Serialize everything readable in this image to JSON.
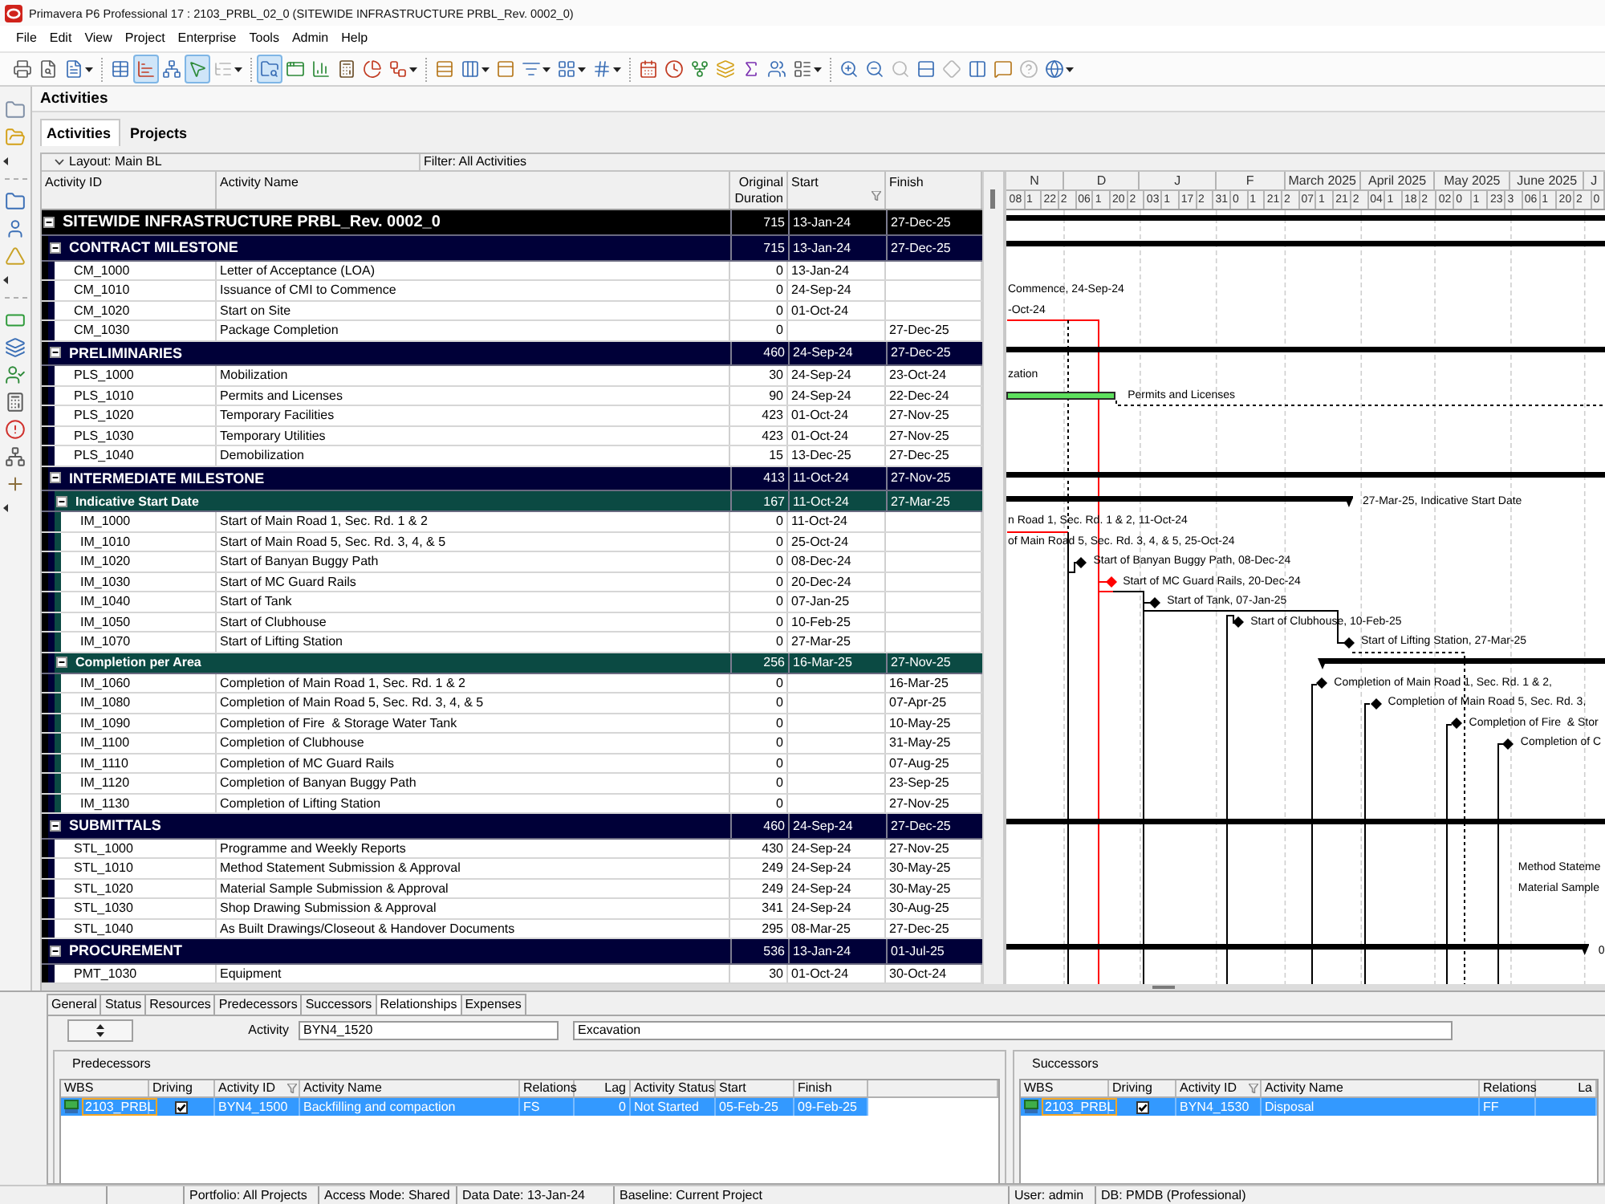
{
  "window": {
    "title": "Primavera P6 Professional 17 : 2103_PRBL_02_0 (SITEWIDE INFRASTRUCTURE PRBL_Rev. 0002_0)"
  },
  "menu": [
    "File",
    "Edit",
    "View",
    "Project",
    "Enterprise",
    "Tools",
    "Admin",
    "Help"
  ],
  "toolbar": [
    [
      {
        "kind": "printer",
        "pressed": false,
        "disabled": false,
        "dropdown": false
      },
      {
        "kind": "preview",
        "pressed": false,
        "disabled": false,
        "dropdown": false
      },
      {
        "kind": "page",
        "pressed": false,
        "disabled": false,
        "dropdown": true
      }
    ],
    [
      {
        "kind": "table",
        "pressed": false,
        "disabled": false,
        "dropdown": false
      },
      {
        "kind": "gantt",
        "pressed": true,
        "disabled": false,
        "dropdown": false
      },
      {
        "kind": "network",
        "pressed": false,
        "disabled": false,
        "dropdown": false
      },
      {
        "kind": "pointer",
        "pressed": true,
        "disabled": false,
        "dropdown": false
      },
      {
        "kind": "hierarchy",
        "pressed": false,
        "disabled": true,
        "dropdown": true
      }
    ],
    [
      {
        "kind": "finder",
        "pressed": true,
        "disabled": false,
        "dropdown": false
      },
      {
        "kind": "window",
        "pressed": false,
        "disabled": false,
        "dropdown": false
      },
      {
        "kind": "bars",
        "pressed": false,
        "disabled": false,
        "dropdown": false
      },
      {
        "kind": "calculator",
        "pressed": false,
        "disabled": false,
        "dropdown": false
      },
      {
        "kind": "chart",
        "pressed": false,
        "disabled": false,
        "dropdown": false
      },
      {
        "kind": "workflow",
        "pressed": false,
        "disabled": false,
        "dropdown": true
      }
    ],
    [
      {
        "kind": "align",
        "pressed": false,
        "disabled": false,
        "dropdown": false
      },
      {
        "kind": "columns",
        "pressed": false,
        "disabled": false,
        "dropdown": true
      },
      {
        "kind": "panel",
        "pressed": false,
        "disabled": false,
        "dropdown": false
      },
      {
        "kind": "filter",
        "pressed": false,
        "disabled": false,
        "dropdown": true
      },
      {
        "kind": "layout",
        "pressed": false,
        "disabled": false,
        "dropdown": true
      },
      {
        "kind": "hash",
        "pressed": false,
        "disabled": false,
        "dropdown": true
      }
    ],
    [
      {
        "kind": "calendar",
        "pressed": false,
        "disabled": false,
        "dropdown": false
      },
      {
        "kind": "clock",
        "pressed": false,
        "disabled": false,
        "dropdown": false
      },
      {
        "kind": "fork",
        "pressed": false,
        "disabled": false,
        "dropdown": false
      },
      {
        "kind": "layers",
        "pressed": false,
        "disabled": false,
        "dropdown": false
      },
      {
        "kind": "sigma",
        "pressed": false,
        "disabled": false,
        "dropdown": false
      },
      {
        "kind": "users",
        "pressed": false,
        "disabled": false,
        "dropdown": false
      },
      {
        "kind": "list",
        "pressed": false,
        "disabled": false,
        "dropdown": true
      }
    ],
    [
      {
        "kind": "zoomin",
        "pressed": false,
        "disabled": false,
        "dropdown": false
      },
      {
        "kind": "zoomout",
        "pressed": false,
        "disabled": false,
        "dropdown": false
      },
      {
        "kind": "magnifier",
        "pressed": false,
        "disabled": true,
        "dropdown": false
      },
      {
        "kind": "rows",
        "pressed": false,
        "disabled": false,
        "dropdown": false
      },
      {
        "kind": "diamond",
        "pressed": false,
        "disabled": true,
        "dropdown": false
      },
      {
        "kind": "split",
        "pressed": false,
        "disabled": false,
        "dropdown": false
      },
      {
        "kind": "message",
        "pressed": false,
        "disabled": false,
        "dropdown": false
      },
      {
        "kind": "help",
        "pressed": false,
        "disabled": true,
        "dropdown": false
      },
      {
        "kind": "globe",
        "pressed": false,
        "disabled": false,
        "dropdown": true
      }
    ]
  ],
  "view": {
    "title": "Activities",
    "tabs": [
      {
        "label": "Activities",
        "selected": true
      },
      {
        "label": "Projects",
        "selected": false
      }
    ],
    "layout": "Layout: Main BL",
    "filter": "Filter: All Activities",
    "columns": [
      {
        "label": "Activity ID",
        "sorted": false
      },
      {
        "label": "Activity Name",
        "sorted": false
      },
      {
        "label": "Original Duration",
        "sorted": false
      },
      {
        "label": "Start",
        "sorted": true
      },
      {
        "label": "Finish",
        "sorted": false
      }
    ],
    "tree": {
      "kind": "wbs",
      "name": "SITEWIDE INFRASTRUCTURE PRBL_Rev. 0002_0",
      "duration": "715",
      "start": "13-Jan-24",
      "finish": "27-Dec-25",
      "expanded": true,
      "gantt": {
        "kind": "summary"
      },
      "children": [
        {
          "kind": "wbs",
          "name": "CONTRACT MILESTONE",
          "duration": "715",
          "start": "13-Jan-24",
          "finish": "27-Dec-25",
          "expanded": true,
          "gantt": {
            "kind": "summary"
          },
          "children": [
            {
              "kind": "activity",
              "id": "CM_1000",
              "name": "Letter of Acceptance (LOA)",
              "duration": "0",
              "start": "13-Jan-24"
            },
            {
              "kind": "activity",
              "id": "CM_1010",
              "name": "Issuance of CMI to Commence",
              "duration": "0",
              "start": "24-Sep-24",
              "gantt": {
                "kind": "clipped",
                "label": "Commence, 24-Sep-24"
              }
            },
            {
              "kind": "activity",
              "id": "CM_1020",
              "name": "Start on Site",
              "duration": "0",
              "start": "01-Oct-24",
              "gantt": {
                "kind": "clipped",
                "label": "-Oct-24"
              }
            },
            {
              "kind": "activity",
              "id": "CM_1030",
              "name": "Package Completion",
              "duration": "0",
              "finish": "27-Dec-25"
            }
          ]
        },
        {
          "kind": "wbs",
          "name": "PRELIMINARIES",
          "duration": "460",
          "start": "24-Sep-24",
          "finish": "27-Dec-25",
          "expanded": true,
          "gantt": {
            "kind": "summary"
          },
          "children": [
            {
              "kind": "activity",
              "id": "PLS_1000",
              "name": "Mobilization",
              "duration": "30",
              "start": "24-Sep-24",
              "finish": "23-Oct-24",
              "gantt": {
                "kind": "clipped",
                "label": "zation"
              }
            },
            {
              "kind": "activity",
              "id": "PLS_1010",
              "name": "Permits and Licenses",
              "duration": "90",
              "start": "24-Sep-24",
              "finish": "22-Dec-24",
              "gantt": {
                "kind": "task",
                "label": "Permits and Licenses",
                "critical": false
              }
            },
            {
              "kind": "activity",
              "id": "PLS_1020",
              "name": "Temporary Facilities",
              "duration": "423",
              "start": "01-Oct-24",
              "finish": "27-Nov-25"
            },
            {
              "kind": "activity",
              "id": "PLS_1030",
              "name": "Temporary Utilities",
              "duration": "423",
              "start": "01-Oct-24",
              "finish": "27-Nov-25"
            },
            {
              "kind": "activity",
              "id": "PLS_1040",
              "name": "Demobilization",
              "duration": "15",
              "start": "13-Dec-25",
              "finish": "27-Dec-25"
            }
          ]
        },
        {
          "kind": "wbs",
          "name": "INTERMEDIATE MILESTONE",
          "duration": "413",
          "start": "11-Oct-24",
          "finish": "27-Nov-25",
          "expanded": true,
          "gantt": {
            "kind": "summary"
          },
          "children": [
            {
              "kind": "wbs",
              "name": "Indicative Start Date",
              "duration": "167",
              "start": "11-Oct-24",
              "finish": "27-Mar-25",
              "expanded": true,
              "gantt": {
                "kind": "summary",
                "label": "27-Mar-25, Indicative Start Date"
              },
              "children": [
                {
                  "kind": "activity",
                  "id": "IM_1000",
                  "name": "Start of Main Road 1, Sec. Rd. 1 & 2",
                  "duration": "0",
                  "start": "11-Oct-24",
                  "gantt": {
                    "kind": "clipped",
                    "label": "n Road 1, Sec. Rd. 1 & 2, 11-Oct-24"
                  }
                },
                {
                  "kind": "activity",
                  "id": "IM_1010",
                  "name": "Start of Main Road 5, Sec. Rd. 3, 4, & 5",
                  "duration": "0",
                  "start": "25-Oct-24",
                  "gantt": {
                    "kind": "clipped",
                    "label": "of Main Road 5, Sec. Rd. 3, 4, & 5, 25-Oct-24"
                  }
                },
                {
                  "kind": "activity",
                  "id": "IM_1020",
                  "name": "Start of Banyan Buggy Path",
                  "duration": "0",
                  "start": "08-Dec-24",
                  "gantt": {
                    "kind": "milestone",
                    "label": "Start of Banyan Buggy Path, 08-Dec-24",
                    "critical": false
                  }
                },
                {
                  "kind": "activity",
                  "id": "IM_1030",
                  "name": "Start of MC Guard Rails",
                  "duration": "0",
                  "start": "20-Dec-24",
                  "gantt": {
                    "kind": "milestone",
                    "label": "Start of MC Guard Rails, 20-Dec-24",
                    "critical": true
                  }
                },
                {
                  "kind": "activity",
                  "id": "IM_1040",
                  "name": "Start of Tank",
                  "duration": "0",
                  "start": "07-Jan-25",
                  "gantt": {
                    "kind": "milestone",
                    "label": "Start of Tank, 07-Jan-25",
                    "critical": false
                  }
                },
                {
                  "kind": "activity",
                  "id": "IM_1050",
                  "name": "Start of Clubhouse",
                  "duration": "0",
                  "start": "10-Feb-25",
                  "gantt": {
                    "kind": "milestone",
                    "label": "Start of Clubhouse, 10-Feb-25",
                    "critical": false
                  }
                },
                {
                  "kind": "activity",
                  "id": "IM_1070",
                  "name": "Start of Lifting Station",
                  "duration": "0",
                  "start": "27-Mar-25",
                  "gantt": {
                    "kind": "milestone",
                    "label": "Start of Lifting Station, 27-Mar-25",
                    "critical": false
                  }
                }
              ]
            },
            {
              "kind": "wbs",
              "name": "Completion per Area",
              "duration": "256",
              "start": "16-Mar-25",
              "finish": "27-Nov-25",
              "expanded": true,
              "gantt": {
                "kind": "summary"
              },
              "children": [
                {
                  "kind": "activity",
                  "id": "IM_1060",
                  "name": "Completion of Main Road 1, Sec. Rd. 1 & 2",
                  "duration": "0",
                  "finish": "16-Mar-25",
                  "gantt": {
                    "kind": "milestone",
                    "label": "Completion of Main Road 1, Sec. Rd. 1 & 2,",
                    "critical": false
                  }
                },
                {
                  "kind": "activity",
                  "id": "IM_1080",
                  "name": "Completion of Main Road 5, Sec. Rd. 3, 4, & 5",
                  "duration": "0",
                  "finish": "07-Apr-25",
                  "gantt": {
                    "kind": "milestone",
                    "label": "Completion of Main Road 5, Sec. Rd. 3,",
                    "critical": false
                  }
                },
                {
                  "kind": "activity",
                  "id": "IM_1090",
                  "name": "Completion of Fire  & Storage Water Tank",
                  "duration": "0",
                  "finish": "10-May-25",
                  "gantt": {
                    "kind": "milestone",
                    "label": "Completion of Fire  & Stor",
                    "critical": false
                  }
                },
                {
                  "kind": "activity",
                  "id": "IM_1100",
                  "name": "Completion of Clubhouse",
                  "duration": "0",
                  "finish": "31-May-25",
                  "gantt": {
                    "kind": "milestone",
                    "label": "Completion of C",
                    "critical": false
                  }
                },
                {
                  "kind": "activity",
                  "id": "IM_1110",
                  "name": "Completion of MC Guard Rails",
                  "duration": "0",
                  "finish": "07-Aug-25"
                },
                {
                  "kind": "activity",
                  "id": "IM_1120",
                  "name": "Completion of Banyan Buggy Path",
                  "duration": "0",
                  "finish": "23-Sep-25"
                },
                {
                  "kind": "activity",
                  "id": "IM_1130",
                  "name": "Completion of Lifting Station",
                  "duration": "0",
                  "finish": "27-Nov-25"
                }
              ]
            }
          ]
        },
        {
          "kind": "wbs",
          "name": "SUBMITTALS",
          "duration": "460",
          "start": "24-Sep-24",
          "finish": "27-Dec-25",
          "expanded": true,
          "gantt": {
            "kind": "summary"
          },
          "children": [
            {
              "kind": "activity",
              "id": "STL_1000",
              "name": "Programme and Weekly Reports",
              "duration": "430",
              "start": "24-Sep-24",
              "finish": "27-Nov-25"
            },
            {
              "kind": "activity",
              "id": "STL_1010",
              "name": "Method Statement Submission & Approval",
              "duration": "249",
              "start": "24-Sep-24",
              "finish": "30-May-25",
              "gantt": {
                "kind": "label",
                "label": "Method Stateme"
              }
            },
            {
              "kind": "activity",
              "id": "STL_1020",
              "name": "Material Sample Submission & Approval",
              "duration": "249",
              "start": "24-Sep-24",
              "finish": "30-May-25",
              "gantt": {
                "kind": "label",
                "label": "Material Sample"
              }
            },
            {
              "kind": "activity",
              "id": "STL_1030",
              "name": "Shop Drawing Submission & Approval",
              "duration": "341",
              "start": "24-Sep-24",
              "finish": "30-Aug-25"
            },
            {
              "kind": "activity",
              "id": "STL_1040",
              "name": "As Built Drawings/Closeout & Handover Documents",
              "duration": "295",
              "start": "08-Mar-25",
              "finish": "27-Dec-25"
            }
          ]
        },
        {
          "kind": "wbs",
          "name": "PROCUREMENT",
          "duration": "536",
          "start": "13-Jan-24",
          "finish": "01-Jul-25",
          "expanded": true,
          "gantt": {
            "kind": "summary",
            "label": "0"
          },
          "children": [
            {
              "kind": "activity",
              "id": "PMT_1030",
              "name": "Equipment",
              "duration": "30",
              "start": "01-Oct-24",
              "finish": "30-Oct-24"
            }
          ]
        }
      ]
    },
    "gantt": {
      "months": [
        "N",
        "D",
        "J",
        "F",
        "March 2025",
        "April 2025",
        "May 2025",
        "June 2025",
        "J"
      ],
      "weeks": [
        "08",
        "1",
        "22",
        "2",
        "06",
        "1",
        "20",
        "2",
        "03",
        "1",
        "17",
        "2",
        "31",
        "0",
        "1",
        "21",
        "2",
        "07",
        "1",
        "21",
        "2",
        "04",
        "1",
        "18",
        "2",
        "02",
        "0",
        "1",
        "23",
        "3",
        "06",
        "1",
        "20",
        "2",
        "0"
      ]
    }
  },
  "details": {
    "tabs": [
      {
        "label": "General",
        "selected": false
      },
      {
        "label": "Status",
        "selected": false
      },
      {
        "label": "Resources",
        "selected": false
      },
      {
        "label": "Predecessors",
        "selected": false
      },
      {
        "label": "Successors",
        "selected": false
      },
      {
        "label": "Relationships",
        "selected": true
      },
      {
        "label": "Expenses",
        "selected": false
      }
    ],
    "activity_label": "Activity",
    "activity_id": "BYN4_1520",
    "activity_name": "Excavation",
    "predecessors": {
      "title": "Predecessors",
      "columns": [
        {
          "label": "WBS",
          "sorted": false
        },
        {
          "label": "Driving",
          "sorted": false
        },
        {
          "label": "Activity ID",
          "sorted": true
        },
        {
          "label": "Activity Name",
          "sorted": false
        },
        {
          "label": "Relations",
          "sorted": false
        },
        {
          "label": "Lag",
          "sorted": false
        },
        {
          "label": "Activity Status",
          "sorted": false
        },
        {
          "label": "Start",
          "sorted": false
        },
        {
          "label": "Finish",
          "sorted": false
        }
      ],
      "rows": [
        {
          "selected": true,
          "wbs": "2103_PRBL",
          "driving": true,
          "activity_id": "BYN4_1500",
          "activity_name": "Backfilling and compaction",
          "relation": "FS",
          "lag": "0",
          "status": "Not Started",
          "start": "05-Feb-25",
          "finish": "09-Feb-25"
        }
      ]
    },
    "successors": {
      "title": "Successors",
      "columns": [
        {
          "label": "WBS",
          "sorted": false
        },
        {
          "label": "Driving",
          "sorted": false
        },
        {
          "label": "Activity ID",
          "sorted": true
        },
        {
          "label": "Activity Name",
          "sorted": false
        },
        {
          "label": "Relations",
          "sorted": false
        },
        {
          "label": "La",
          "sorted": false
        }
      ],
      "rows": [
        {
          "selected": true,
          "wbs": "2103_PRBL",
          "driving": true,
          "activity_id": "BYN4_1530",
          "activity_name": "Disposal",
          "relation": "FF"
        }
      ]
    }
  },
  "status_bar": [
    "Portfolio: All Projects",
    "Access Mode: Shared",
    "Data Date: 13-Jan-24",
    "Baseline: Current Project",
    "User: admin",
    "DB: PMDB (Professional)"
  ]
}
